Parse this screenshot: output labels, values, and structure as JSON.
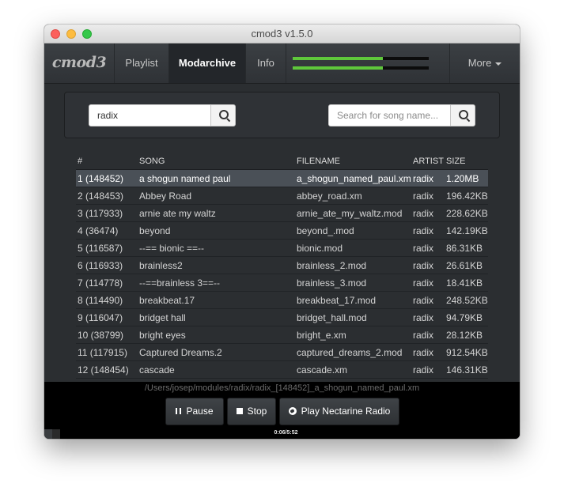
{
  "window": {
    "title": "cmod3 v1.5.0"
  },
  "nav": {
    "brand": "cmod3",
    "items": [
      {
        "label": "Playlist",
        "active": false
      },
      {
        "label": "Modarchive",
        "active": true
      },
      {
        "label": "Info",
        "active": false
      }
    ],
    "more_label": "More",
    "vu_levels": [
      0.66,
      0.66
    ]
  },
  "search": {
    "artist_value": "radix",
    "song_placeholder": "Search for song name..."
  },
  "table": {
    "columns": [
      "#",
      "SONG",
      "FILENAME",
      "ARTIST",
      "SIZE"
    ],
    "rows": [
      {
        "num": "1 (148452)",
        "song": "a shogun named paul",
        "filename": "a_shogun_named_paul.xm",
        "artist": "radix",
        "size": "1.20MB",
        "selected": true
      },
      {
        "num": "2 (148453)",
        "song": "Abbey Road",
        "filename": "abbey_road.xm",
        "artist": "radix",
        "size": "196.42KB"
      },
      {
        "num": "3 (117933)",
        "song": "arnie ate my waltz",
        "filename": "arnie_ate_my_waltz.mod",
        "artist": "radix",
        "size": "228.62KB"
      },
      {
        "num": "4 (36474)",
        "song": "beyond",
        "filename": "beyond_.mod",
        "artist": "radix",
        "size": "142.19KB"
      },
      {
        "num": "5 (116587)",
        "song": "--== bionic ==--",
        "filename": "bionic.mod",
        "artist": "radix",
        "size": "86.31KB"
      },
      {
        "num": "6 (116933)",
        "song": "brainless2",
        "filename": "brainless_2.mod",
        "artist": "radix",
        "size": "26.61KB"
      },
      {
        "num": "7 (114778)",
        "song": "--==brainless 3==--",
        "filename": "brainless_3.mod",
        "artist": "radix",
        "size": "18.41KB"
      },
      {
        "num": "8 (114490)",
        "song": "breakbeat.17",
        "filename": "breakbeat_17.mod",
        "artist": "radix",
        "size": "248.52KB"
      },
      {
        "num": "9 (116047)",
        "song": "bridget hall",
        "filename": "bridget_hall.mod",
        "artist": "radix",
        "size": "94.79KB"
      },
      {
        "num": "10 (38799)",
        "song": "bright eyes",
        "filename": "bright_e.xm",
        "artist": "radix",
        "size": "28.12KB"
      },
      {
        "num": "11 (117915)",
        "song": "Captured Dreams.2",
        "filename": "captured_dreams_2.mod",
        "artist": "radix",
        "size": "912.54KB"
      },
      {
        "num": "12 (148454)",
        "song": "cascade",
        "filename": "cascade.xm",
        "artist": "radix",
        "size": "146.31KB"
      }
    ]
  },
  "player": {
    "file_path": "/Users/josep/modules/radix/radix_[148452]_a_shogun_named_paul.xm",
    "pause_label": "Pause",
    "stop_label": "Stop",
    "radio_label": "Play Nectarine Radio",
    "progress_text": "0:06/5:52",
    "progress_fraction": 0.017
  },
  "colors": {
    "accent_green": "#5fc83b",
    "background_dark": "#2b2e31",
    "selected_row": "#4a5057"
  }
}
